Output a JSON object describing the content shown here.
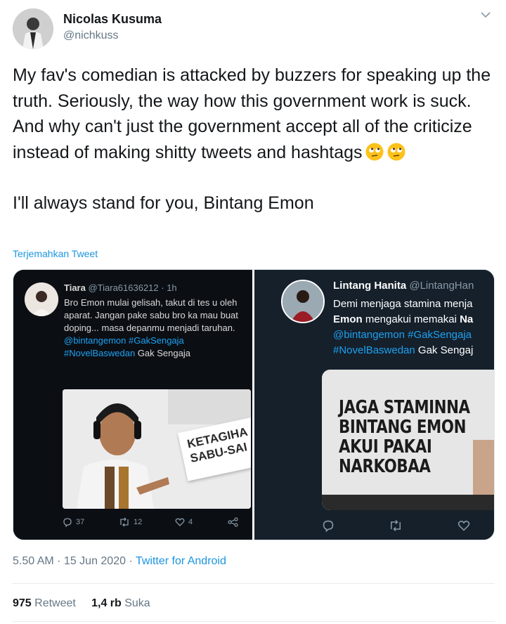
{
  "author": {
    "display_name": "Nicolas Kusuma",
    "handle": "@nichkuss"
  },
  "tweet": {
    "paragraph1": "My fav's comedian is attacked by buzzers for speaking up the truth. Seriously, the way how this government work is suck. And why can't just the government accept all of the criticize instead of making shitty tweets and hashtags",
    "paragraph2": "I'll always stand for you, Bintang Emon",
    "emojis": [
      "face-with-rolling-eyes-icon",
      "face-with-rolling-eyes-icon"
    ],
    "translate_label": "Terjemahkan Tweet"
  },
  "media": {
    "left": {
      "name": "Tiara",
      "handle_time": "@Tiara61636212 · 1h",
      "body_plain": "Bro Emon mulai gelisah, takut di tes u oleh aparat. Jangan pake sabu bro ka mau buat doping... masa depanmu menjadi taruhan.",
      "mention": "@bintangemon",
      "hashtags": "#GakSengaja #NovelBaswedan",
      "tail": "Gak Sengaja",
      "image_sign": "KETAGIHA\nSABU-SAI",
      "replies": "37",
      "retweets": "12",
      "likes": "4"
    },
    "right": {
      "name": "Lintang Hanita",
      "handle": "@LintangHan",
      "line1": "Demi menjaga stamina menja",
      "line2_bold": "Emon",
      "line2_rest": "mengakui memakai",
      "line2_end": "Na",
      "line3": "@bintangemon #GakSengaja",
      "line4_tags": "#NovelBaswedan",
      "line4_tail": "Gak Sengaj",
      "headline": "JAGA STAMINNA\nBINTANG EMON\nAKUI PAKAI\nNARKOBAA"
    }
  },
  "meta": {
    "time_date": "5.50 AM · 15 Jun 2020 ·",
    "source": "Twitter for Android"
  },
  "stats": {
    "retweets_count": "975",
    "retweets_label": "Retweet",
    "likes_count": "1,4 rb",
    "likes_label": "Suka"
  },
  "colors": {
    "link": "#1b95e0",
    "muted": "#657786",
    "dark_panel": "#15202b"
  }
}
